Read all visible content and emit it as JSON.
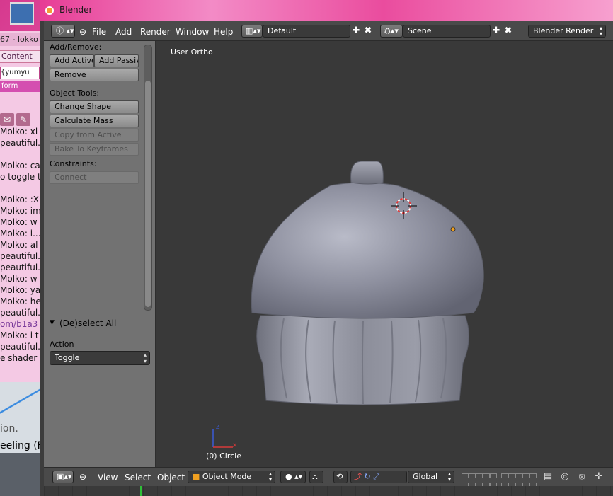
{
  "window": {
    "title": "Blender"
  },
  "chat": {
    "title": "67 - lokko",
    "tab": "Content",
    "nick": "{yumyu",
    "form": "form",
    "log": [
      "Molko: xl",
      "peautiful.e",
      "",
      "Molko: ca",
      "o toggle t",
      "",
      "Molko: :X",
      "Molko: im",
      "Molko: w",
      "Molko: i...",
      "Molko: al",
      "peautiful.e",
      "peautiful.e",
      "Molko: w",
      "Molko: ya",
      "Molko: he",
      "peautiful.e",
      "om/b1a3",
      "Molko: i t",
      "peautiful.e",
      "e shader"
    ],
    "lower_text_1": "ion.",
    "lower_text_2": "eeling (F"
  },
  "info_header": {
    "menus": [
      "File",
      "Add",
      "Render",
      "Window",
      "Help"
    ],
    "layout": "Default",
    "scene": "Scene",
    "engine": "Blender Render"
  },
  "toolshelf": {
    "add_remove_label": "Add/Remove:",
    "add_active": "Add Active",
    "add_passive": "Add Passiv",
    "remove": "Remove",
    "object_tools_label": "Object Tools:",
    "change_shape": "Change Shape",
    "calculate_mass": "Calculate Mass",
    "copy_from_active": "Copy from Active",
    "bake_to_keyframes": "Bake To Keyframes",
    "constraints_label": "Constraints:",
    "connect": "Connect",
    "operator_title": "(De)select All",
    "action_label": "Action",
    "action_value": "Toggle"
  },
  "viewport": {
    "view_name": "User Ortho",
    "object_name": "(0) Circle",
    "object_color": "#8d8f9e"
  },
  "view3d_header": {
    "menus": [
      "View",
      "Select",
      "Object"
    ],
    "mode": "Object Mode",
    "orientation": "Global"
  }
}
